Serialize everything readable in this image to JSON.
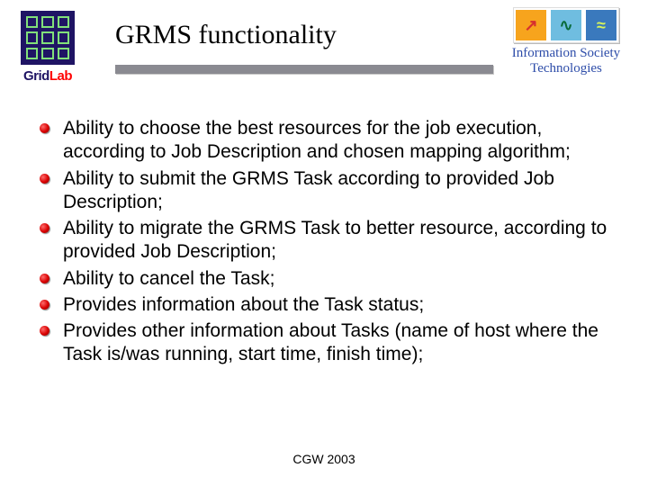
{
  "title": "GRMS functionality",
  "logo_left": {
    "line1": "Grid",
    "line2": "Lab"
  },
  "logo_right": {
    "top": "Information Society",
    "bottom": "Technologies",
    "glyphs": [
      "↗",
      "∿",
      "≈"
    ]
  },
  "bullets": [
    "Ability to choose the best resources for the job execution, according to Job Description and chosen mapping algorithm;",
    "Ability to submit the GRMS Task according to provided Job Description;",
    "Ability to migrate the GRMS Task to better resource, according to provided Job Description;",
    "Ability to cancel the Task;",
    "Provides information about the Task status;",
    "Provides other information about Tasks (name of host where the Task is/was running, start time, finish time);"
  ],
  "footer": "CGW 2003"
}
